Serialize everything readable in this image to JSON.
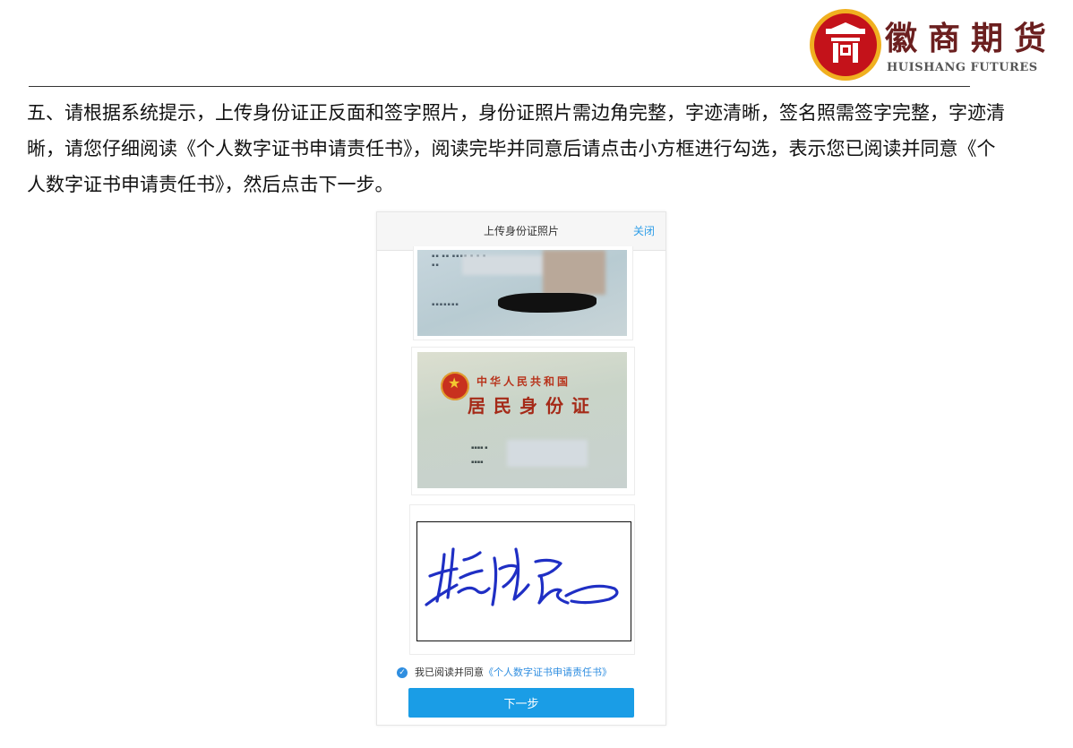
{
  "logo": {
    "name_cn": "徽商期货",
    "name_en": "HUISHANG FUTURES",
    "colors": {
      "ring": "#f0b020",
      "disc": "#c4121a",
      "text": "#6b1f1f"
    }
  },
  "instruction": "五、请根据系统提示，上传身份证正反面和签字照片，身份证照片需边角完整，字迹清晰，签名照需签字完整，字迹清晰，请您仔细阅读《个人数字证书申请责任书》，阅读完毕并同意后请点击小方框进行勾选，表示您已阅读并同意《个人数字证书申请责任书》，然后点击下一步。",
  "panel": {
    "title": "上传身份证照片",
    "close_label": "关闭",
    "id_front": {
      "country": "中华人民共和国",
      "card_name": "居民身份证"
    },
    "agree_prefix": "我已阅读并同意",
    "agree_link": "《个人数字证书申请责任书》",
    "next_label": "下一步",
    "accent_color": "#1a9de6"
  }
}
